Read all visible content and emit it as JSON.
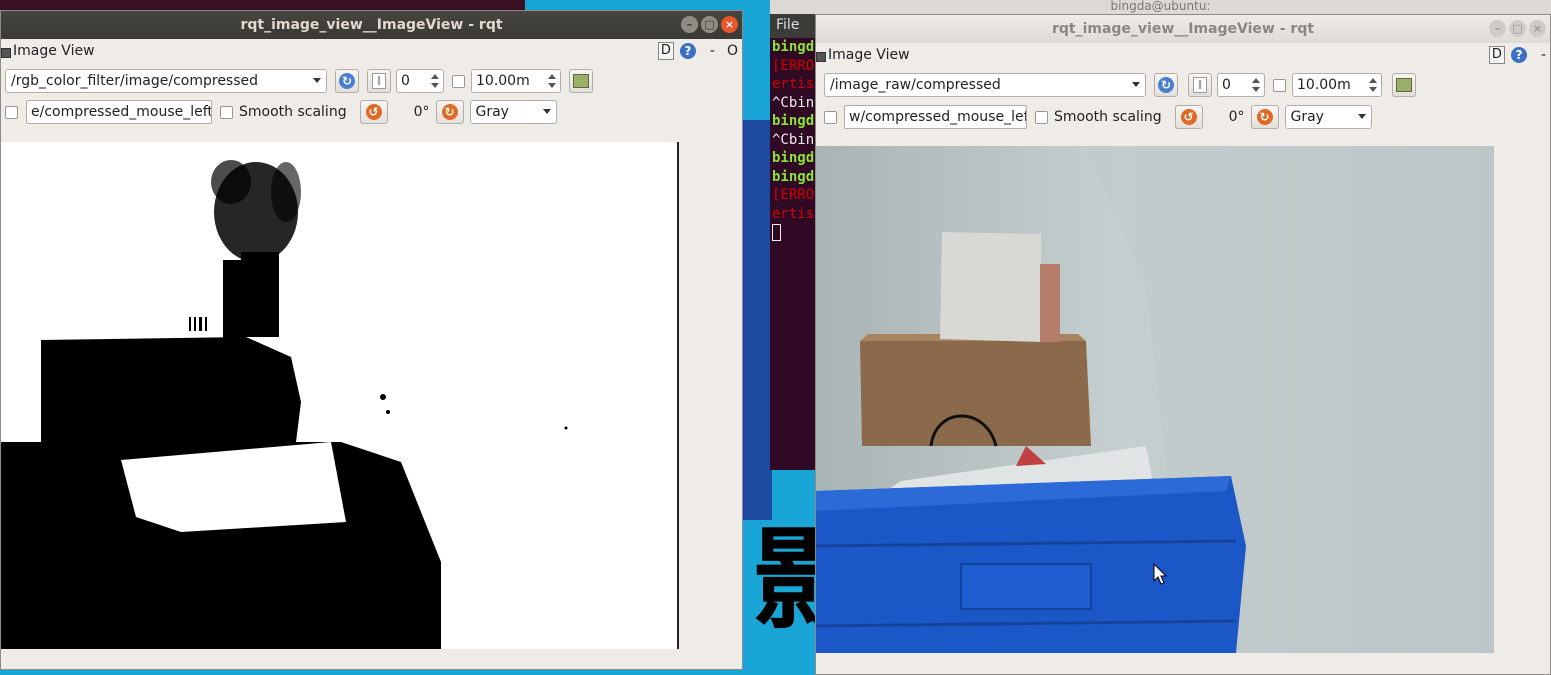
{
  "desktop": {
    "big_glyph": "影"
  },
  "terminal": {
    "title": "bingda@ubuntu:",
    "menu_file": "File",
    "lines": [
      {
        "text": "bingd",
        "style": "g"
      },
      {
        "text": "[ERRO",
        "style": "r"
      },
      {
        "text": "ertis",
        "style": "r"
      },
      {
        "text": "^Cbin",
        "style": "w"
      },
      {
        "text": "bingd",
        "style": "g"
      },
      {
        "text": "^Cbin",
        "style": "w"
      },
      {
        "text": "bingd",
        "style": "g"
      },
      {
        "text": "bingd",
        "style": "g"
      },
      {
        "text": "[ERRO",
        "style": "r"
      },
      {
        "text": "ertis",
        "style": "r"
      }
    ]
  },
  "left_window": {
    "title": "rqt_image_view__ImageView - rqt",
    "plugin_title": "Image View",
    "d_label": "D",
    "help": "?",
    "dash": "-",
    "o_label": "O",
    "topic": "/rgb_color_filter/image/compressed",
    "frame_value": "0",
    "timeout_value": "10.00m",
    "mouse_topic": "e/compressed_mouse_left",
    "smooth_label": "Smooth scaling",
    "rotation": "0°",
    "color_scheme": "Gray"
  },
  "right_window": {
    "title": "rqt_image_view__ImageView - rqt",
    "plugin_title": "Image View",
    "d_label": "D",
    "help": "?",
    "dash": "-",
    "topic": "/image_raw/compressed",
    "frame_value": "0",
    "timeout_value": "10.00m",
    "mouse_topic": "w/compressed_mouse_left",
    "smooth_label": "Smooth scaling",
    "rotation": "0°",
    "color_scheme": "Gray"
  },
  "window_buttons": {
    "minimize": "–",
    "maximize": "□",
    "close": "×"
  }
}
